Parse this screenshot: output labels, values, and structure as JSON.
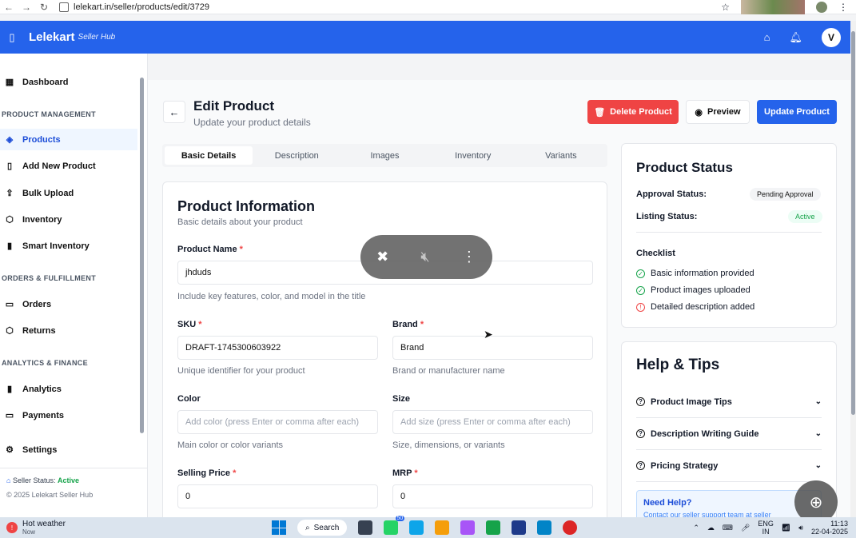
{
  "browser": {
    "url": "lelekart.in/seller/products/edit/3729"
  },
  "header": {
    "brand": "Lelekart",
    "brand_sub": "Seller Hub",
    "user_initial": "V"
  },
  "sidebar": {
    "dashboard": "Dashboard",
    "section_product": "PRODUCT MANAGEMENT",
    "products": "Products",
    "add_new": "Add New Product",
    "bulk_upload": "Bulk Upload",
    "inventory": "Inventory",
    "smart_inventory": "Smart Inventory",
    "section_orders": "ORDERS & FULFILLMENT",
    "orders": "Orders",
    "returns": "Returns",
    "section_analytics": "ANALYTICS & FINANCE",
    "analytics": "Analytics",
    "payments": "Payments",
    "settings": "Settings",
    "seller_status_label": "Seller Status:",
    "seller_status_value": "Active",
    "copyright": "© 2025 Lelekart Seller Hub"
  },
  "page": {
    "title": "Edit Product",
    "subtitle": "Update your product details",
    "delete_label": "Delete Product",
    "preview_label": "Preview",
    "update_label": "Update Product"
  },
  "tabs": [
    "Basic Details",
    "Description",
    "Images",
    "Inventory",
    "Variants"
  ],
  "product_info": {
    "title": "Product Information",
    "subtitle": "Basic details about your product",
    "name_label": "Product Name",
    "name_value": "jhduds",
    "name_hint": "Include key features, color, and model in the title",
    "sku_label": "SKU",
    "sku_value": "DRAFT-1745300603922",
    "sku_hint": "Unique identifier for your product",
    "brand_label": "Brand",
    "brand_value": "Brand",
    "brand_hint": "Brand or manufacturer name",
    "color_label": "Color",
    "color_placeholder": "Add color (press Enter or comma after each)",
    "color_hint": "Main color or color variants",
    "size_label": "Size",
    "size_placeholder": "Add size (press Enter or comma after each)",
    "size_hint": "Size, dimensions, or variants",
    "selling_label": "Selling Price",
    "selling_value": "0",
    "mrp_label": "MRP",
    "mrp_value": "0",
    "required_mark": "*"
  },
  "status": {
    "title": "Product Status",
    "approval_label": "Approval Status:",
    "approval_value": "Pending Approval",
    "listing_label": "Listing Status:",
    "listing_value": "Active",
    "checklist_title": "Checklist",
    "checklist": [
      {
        "label": "Basic information provided",
        "state": "ok"
      },
      {
        "label": "Product images uploaded",
        "state": "ok"
      },
      {
        "label": "Detailed description added",
        "state": "warn"
      }
    ]
  },
  "help": {
    "title": "Help & Tips",
    "items": [
      "Product Image Tips",
      "Description Writing Guide",
      "Pricing Strategy"
    ],
    "need_help_title": "Need Help?",
    "need_help_text": "Contact our seller support team at seller"
  },
  "taskbar": {
    "weather_title": "Hot weather",
    "weather_sub": "Now",
    "search_label": "Search",
    "lang_top": "ENG",
    "lang_bottom": "IN",
    "time": "11:13",
    "date": "22-04-2025",
    "badge_count": "50"
  },
  "colors": {
    "primary": "#2563eb",
    "danger": "#ef4444",
    "success": "#16a34a"
  }
}
